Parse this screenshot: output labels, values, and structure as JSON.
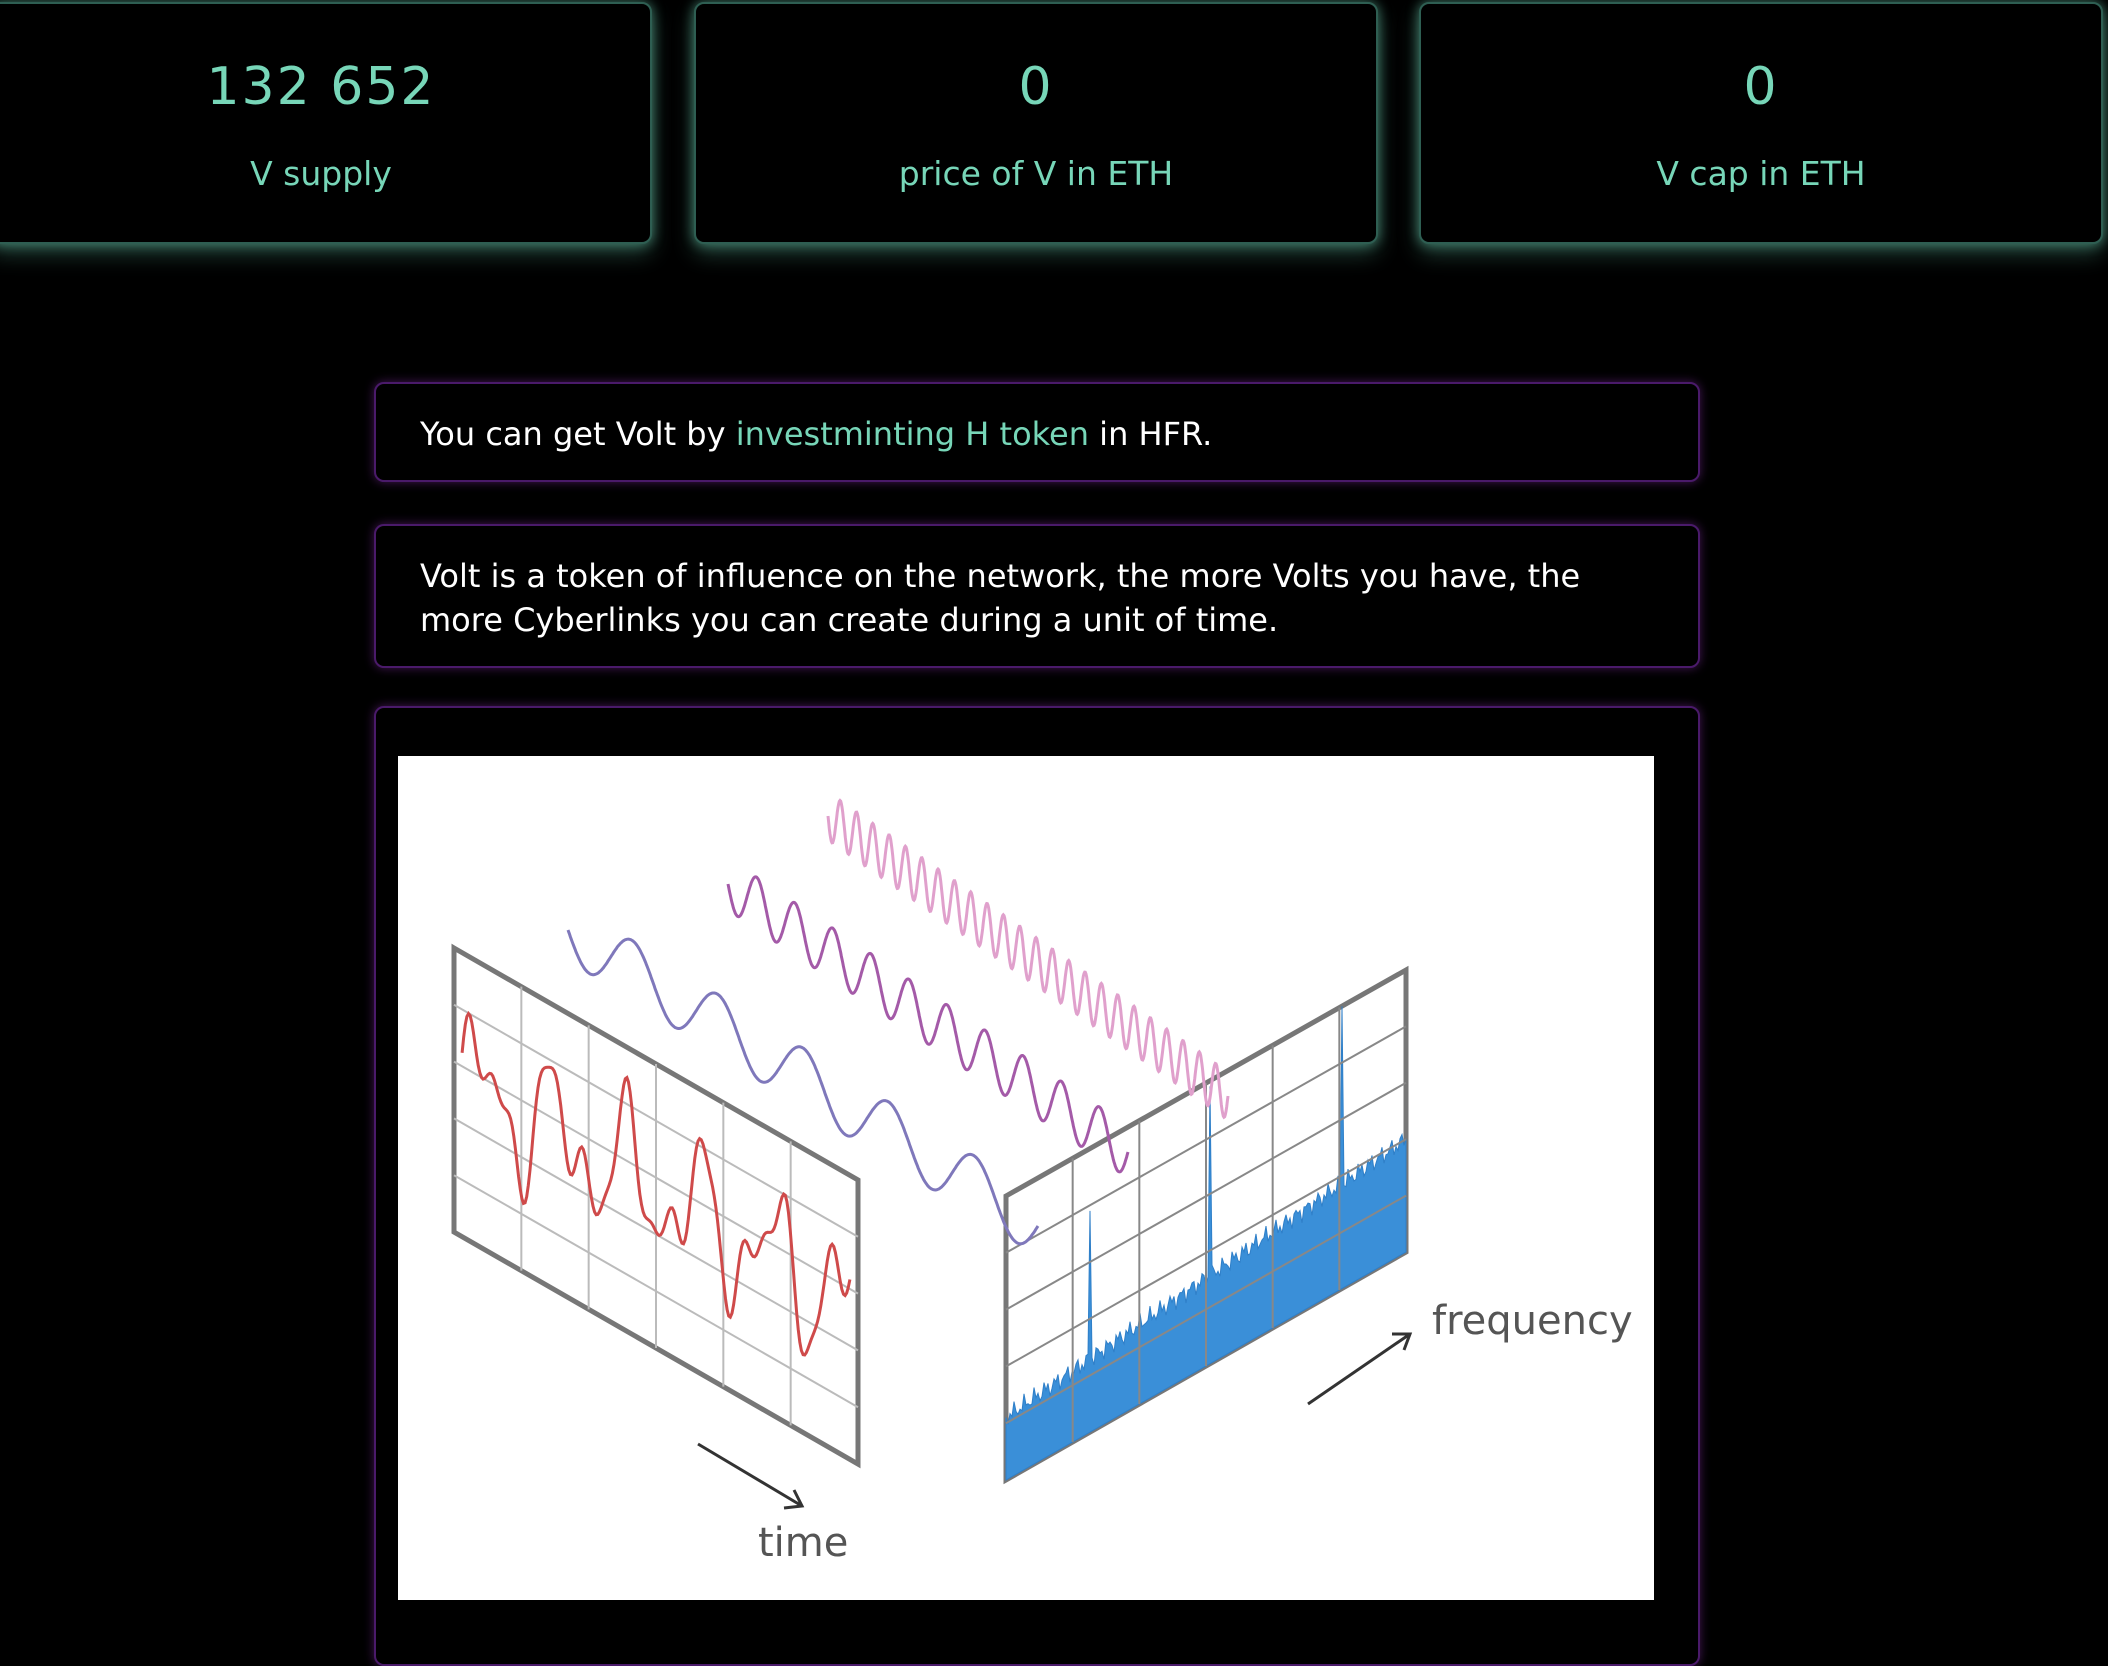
{
  "stats": [
    {
      "value": "132 652",
      "label": "V supply"
    },
    {
      "value": "0",
      "label": "price of V in ETH"
    },
    {
      "value": "0",
      "label": "V cap in ETH"
    }
  ],
  "info1": {
    "prefix": "You can get Volt by ",
    "link": "investminting H token",
    "suffix": " in HFR."
  },
  "info2": {
    "line1": "Volt is a token of influence on the network, the more Volts you have, the",
    "line2": "more Cyberlinks you can create during a unit of time."
  },
  "illustration": {
    "time_label": "time",
    "frequency_label": "frequency",
    "colors": {
      "signal": "#cf4a4a",
      "spectrum": "#3a8fd8",
      "wave1": "#7f78bb",
      "wave2": "#a45aa8",
      "wave3": "#e0a0cc",
      "grid": "#777777"
    }
  }
}
